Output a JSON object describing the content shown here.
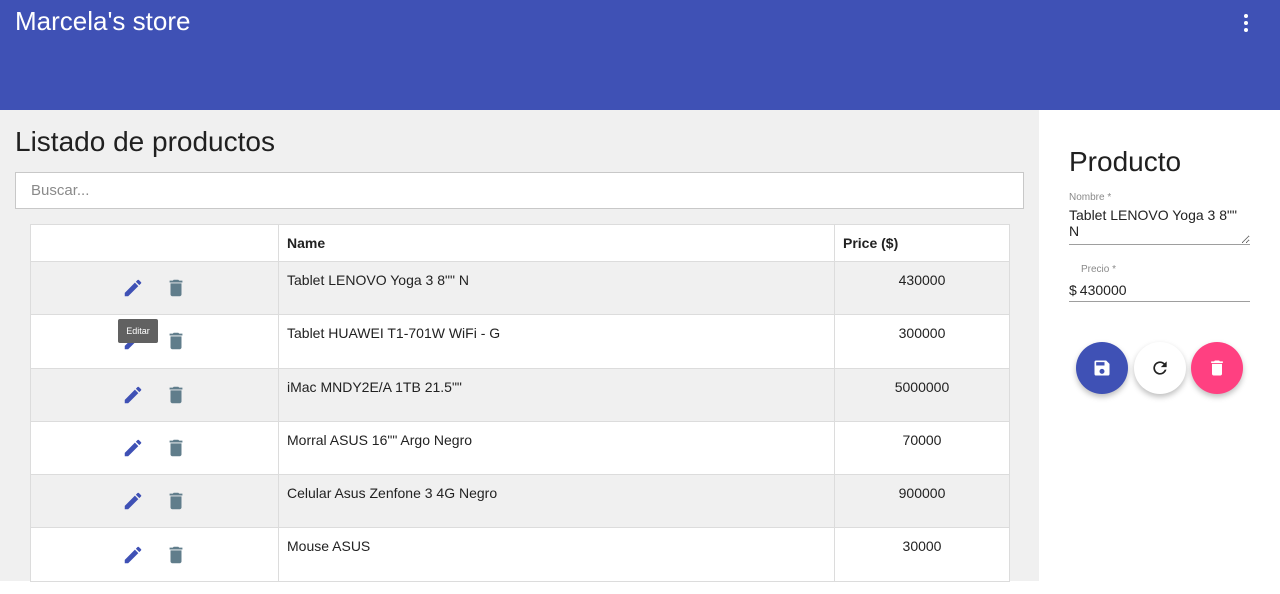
{
  "header": {
    "title": "Marcela's store"
  },
  "list": {
    "title": "Listado de productos",
    "search_placeholder": "Buscar...",
    "columns": {
      "actions": "",
      "name": "Name",
      "price": "Price ($)"
    },
    "rows": [
      {
        "name": "Tablet LENOVO Yoga 3 8\"\" N",
        "price": "430000"
      },
      {
        "name": "Tablet HUAWEI T1-701W WiFi - G",
        "price": "300000"
      },
      {
        "name": "iMac MNDY2E/A 1TB 21.5\"\"",
        "price": "5000000"
      },
      {
        "name": "Morral ASUS 16\"\" Argo Negro",
        "price": "70000"
      },
      {
        "name": "Celular Asus Zenfone 3 4G Negro",
        "price": "900000"
      },
      {
        "name": "Mouse ASUS",
        "price": "30000"
      }
    ],
    "tooltip": "Editar"
  },
  "form": {
    "title": "Producto",
    "name_label": "Nombre *",
    "name_value": "Tablet LENOVO Yoga 3 8\"\" N",
    "price_label": "Precio *",
    "price_prefix": "$",
    "price_value": "430000"
  },
  "icons": {
    "menu": "more-vert-icon",
    "edit": "pencil-icon",
    "delete": "trash-icon",
    "save": "floppy-disk-icon",
    "refresh": "refresh-icon",
    "fab_delete": "trash-icon"
  },
  "colors": {
    "primary": "#3f51b5",
    "accent": "#ff4081",
    "delete_icon": "#607d8b"
  }
}
